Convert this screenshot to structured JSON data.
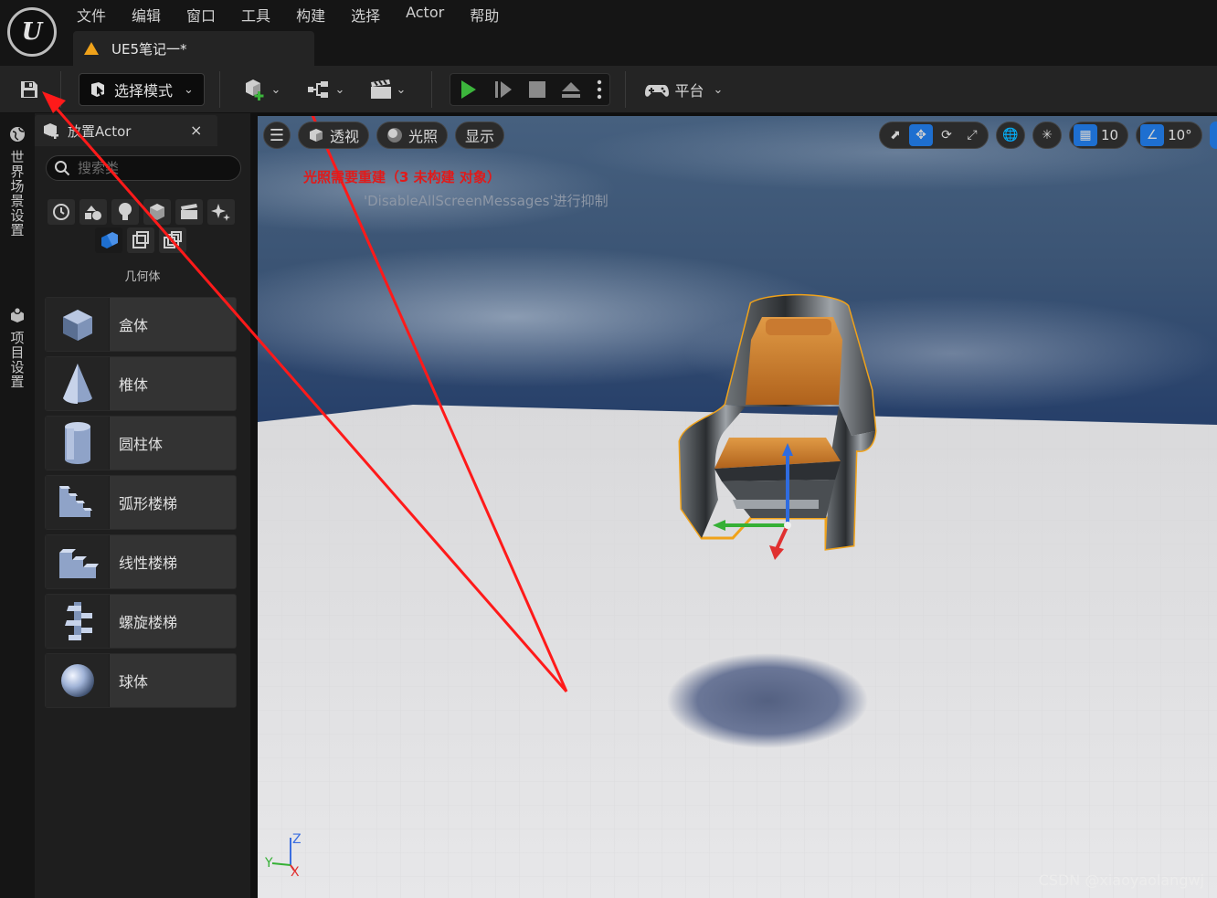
{
  "app": {
    "logo_text": "U"
  },
  "menu": [
    "文件",
    "编辑",
    "窗口",
    "工具",
    "构建",
    "选择",
    "Actor",
    "帮助"
  ],
  "document_tab": {
    "label": "UE5笔记一*"
  },
  "toolbar": {
    "mode_label": "选择模式",
    "platform_label": "平台"
  },
  "dock": {
    "tabs": [
      "世界场景设置",
      "项目设置"
    ]
  },
  "place_actors": {
    "tab_label": "放置Actor",
    "close_glyph": "×",
    "search_placeholder": "搜索类",
    "category_label": "几何体",
    "items": [
      {
        "label": "盒体",
        "icon": "box-shape-icon"
      },
      {
        "label": "椎体",
        "icon": "cone-shape-icon"
      },
      {
        "label": "圆柱体",
        "icon": "cylinder-shape-icon"
      },
      {
        "label": "弧形楼梯",
        "icon": "curved-stair-icon"
      },
      {
        "label": "线性楼梯",
        "icon": "linear-stair-icon"
      },
      {
        "label": "螺旋楼梯",
        "icon": "spiral-stair-icon"
      },
      {
        "label": "球体",
        "icon": "sphere-shape-icon"
      }
    ]
  },
  "viewport": {
    "perspective_label": "透视",
    "lighting_label": "光照",
    "show_label": "显示",
    "grid_snap_value": "10",
    "rotation_snap_value": "10°",
    "warning": "光照需要重建（3 未构建 对象）",
    "hint": "'DisableAllScreenMessages'进行抑制",
    "axis_labels": {
      "z": "Z",
      "y": "Y",
      "x": "X"
    }
  },
  "watermark": "CSDN @xiaoyaolangwj",
  "colors": {
    "accent": "#1e6fd0",
    "play_green": "#3cb53c",
    "warning_red": "#e01b1b",
    "annotation_arrow": "#ff1a1a",
    "chair_cushion": "#d9832c",
    "selection_outline": "#f0a21a"
  }
}
